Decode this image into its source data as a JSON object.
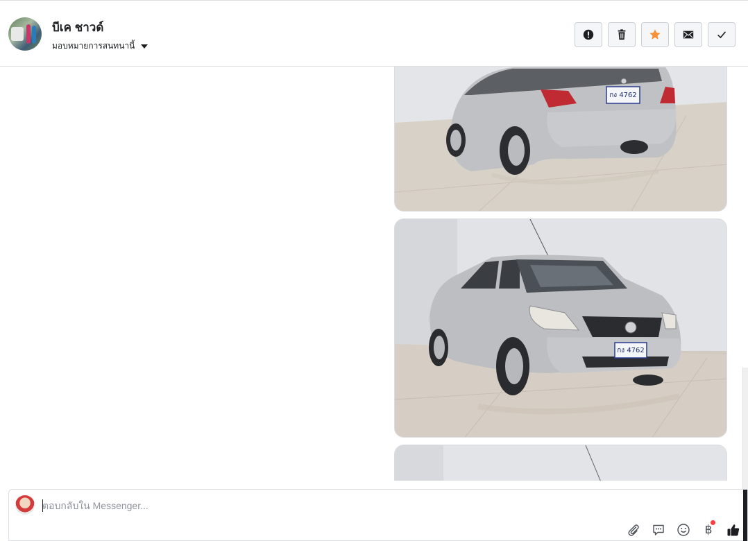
{
  "header": {
    "contact_name": "บีเค ชาวด์",
    "assign_label": "มอบหมายการสนทนานี้"
  },
  "toolbar": {
    "buttons": [
      {
        "name": "spam",
        "icon": "alert-circle-icon"
      },
      {
        "name": "delete",
        "icon": "trash-icon"
      },
      {
        "name": "star",
        "icon": "star-icon",
        "color": "#f7923b"
      },
      {
        "name": "mark-unread",
        "icon": "envelope-icon"
      },
      {
        "name": "done",
        "icon": "checkmark-icon"
      }
    ]
  },
  "thread": {
    "photos": [
      {
        "desc": "silver sedan rear view",
        "plate": "กง 4762"
      },
      {
        "desc": "silver sedan front view",
        "plate": "กง 4762"
      },
      {
        "desc": "partial photo"
      }
    ]
  },
  "composer": {
    "placeholder": "ตอบกลับใน Messenger...",
    "icons": [
      "paperclip-icon",
      "chat-bubble-icon",
      "emoji-icon",
      "baht-icon",
      "thumbs-up-icon"
    ],
    "baht_symbol": "฿",
    "thumbs_color": "#1c1e21"
  }
}
